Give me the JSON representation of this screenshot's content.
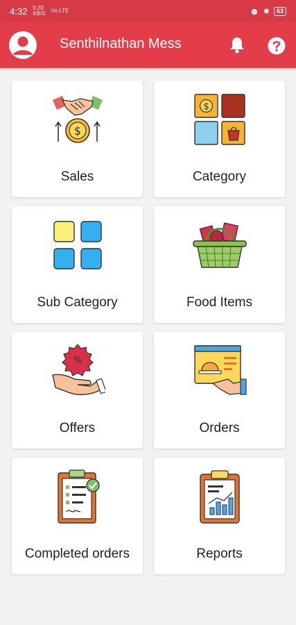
{
  "status_bar": {
    "time": "4:32",
    "signal_top": "0.20",
    "signal_bottom": "KB/S",
    "network": "Vo LTE",
    "battery": "63"
  },
  "app_bar": {
    "title": "Senthilnathan Mess",
    "avatar_icon": "account-circle-icon",
    "bell_icon": "notification-bell-icon",
    "help_icon": "help-question-icon"
  },
  "colors": {
    "brand": "#e33d4a",
    "background": "#f2f2f2",
    "tile": "#ffffff"
  },
  "tiles": [
    {
      "label": "Sales",
      "icon": "handshake-money-icon"
    },
    {
      "label": "Category",
      "icon": "category-grid-icon"
    },
    {
      "label": "Sub Category",
      "icon": "subcategory-squares-icon"
    },
    {
      "label": "Food Items",
      "icon": "food-basket-icon"
    },
    {
      "label": "Offers",
      "icon": "offer-hand-icon"
    },
    {
      "label": "Orders",
      "icon": "online-order-icon"
    },
    {
      "label": "Completed orders",
      "icon": "completed-clipboard-icon"
    },
    {
      "label": "Reports",
      "icon": "report-clipboard-icon"
    }
  ]
}
